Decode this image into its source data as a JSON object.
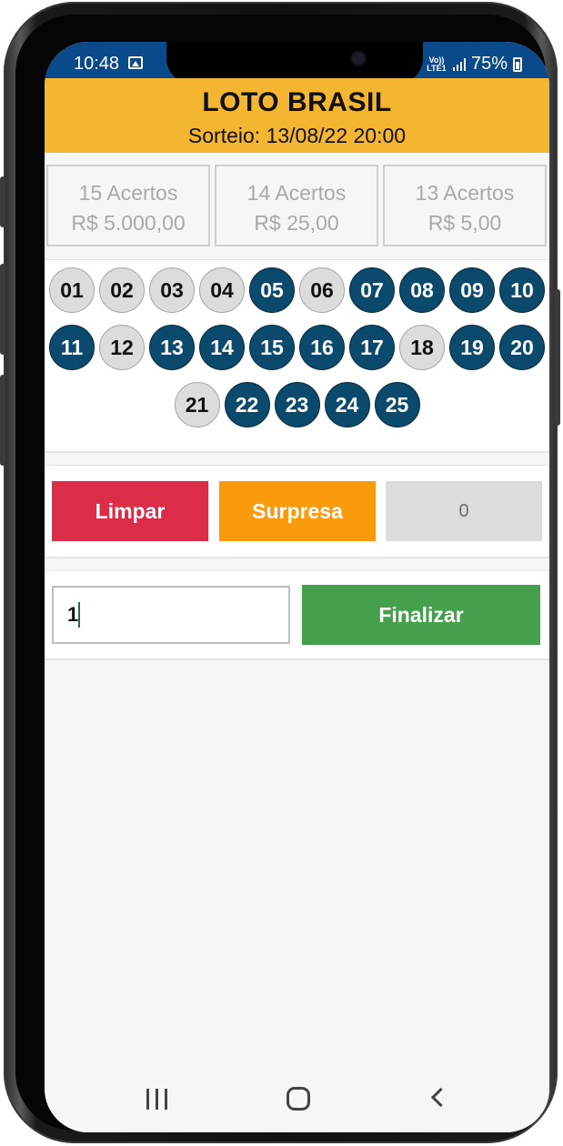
{
  "status_bar": {
    "time": "10:48",
    "network_label": "Vo)) LTE1",
    "battery": "75%"
  },
  "header": {
    "title": "LOTO BRASIL",
    "subtitle": "Sorteio: 13/08/22 20:00",
    "background_color": "#f4b631"
  },
  "prizes": [
    {
      "label": "15 Acertos",
      "value": "R$ 5.000,00"
    },
    {
      "label": "14 Acertos",
      "value": "R$ 25,00"
    },
    {
      "label": "13 Acertos",
      "value": "R$ 5,00"
    }
  ],
  "numbers": [
    {
      "label": "01",
      "selected": false
    },
    {
      "label": "02",
      "selected": false
    },
    {
      "label": "03",
      "selected": false
    },
    {
      "label": "04",
      "selected": false
    },
    {
      "label": "05",
      "selected": true
    },
    {
      "label": "06",
      "selected": false
    },
    {
      "label": "07",
      "selected": true
    },
    {
      "label": "08",
      "selected": true
    },
    {
      "label": "09",
      "selected": true
    },
    {
      "label": "10",
      "selected": true
    },
    {
      "label": "11",
      "selected": true
    },
    {
      "label": "12",
      "selected": false
    },
    {
      "label": "13",
      "selected": true
    },
    {
      "label": "14",
      "selected": true
    },
    {
      "label": "15",
      "selected": true
    },
    {
      "label": "16",
      "selected": true
    },
    {
      "label": "17",
      "selected": true
    },
    {
      "label": "18",
      "selected": false
    },
    {
      "label": "19",
      "selected": true
    },
    {
      "label": "20",
      "selected": true
    },
    {
      "label": "21",
      "selected": false
    },
    {
      "label": "22",
      "selected": true
    },
    {
      "label": "23",
      "selected": true
    },
    {
      "label": "24",
      "selected": true
    },
    {
      "label": "25",
      "selected": true
    }
  ],
  "actions": {
    "clear_label": "Limpar",
    "surprise_label": "Surpresa",
    "selected_count": "0",
    "clear_color": "#db2d47",
    "surprise_color": "#fa9b0d"
  },
  "finalize": {
    "quantity_value": "1",
    "button_label": "Finalizar",
    "button_color": "#45a04c"
  },
  "colors": {
    "ball_selected": "#0b4a6c",
    "ball_unselected": "#dcdcdc",
    "status_bar": "#0a4a8a"
  },
  "icons": {
    "status": [
      "gallery-icon",
      "signal-icon",
      "battery-icon"
    ],
    "nav": [
      "recent-apps-icon",
      "home-icon",
      "back-icon"
    ]
  }
}
